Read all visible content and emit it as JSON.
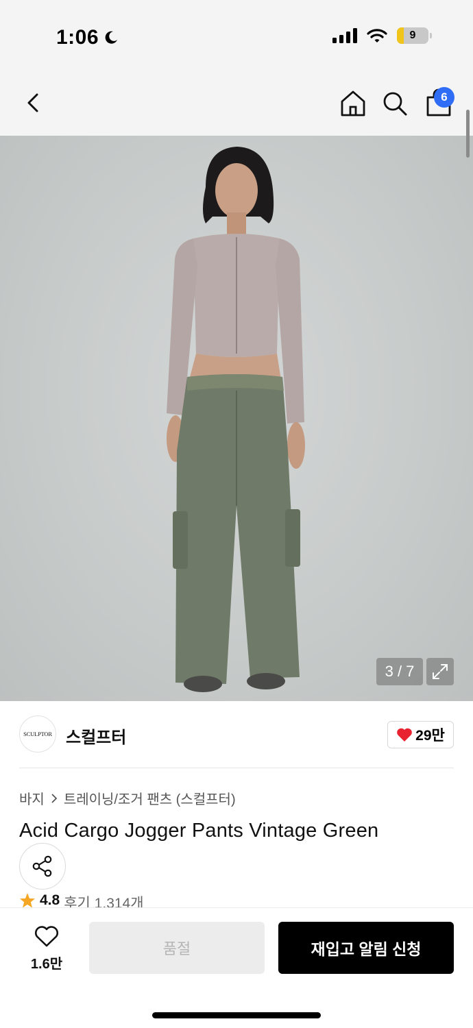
{
  "status_bar": {
    "time": "1:06",
    "battery_level": "9",
    "battery_fraction": 0.09,
    "icons": [
      "moon-icon",
      "cellular-signal-icon",
      "wifi-icon",
      "battery-icon"
    ]
  },
  "nav": {
    "icons": [
      "back-arrow-icon",
      "home-icon",
      "search-icon",
      "shopping-bag-icon"
    ],
    "cart_count": "6"
  },
  "gallery": {
    "counter": "3 / 7",
    "current": 3,
    "total": 7,
    "expand_icon": "expand-arrows-icon"
  },
  "brand": {
    "logo_text": "SCULPTOR",
    "name": "스컬프터",
    "likes": "29만"
  },
  "product": {
    "breadcrumb": [
      "바지",
      "트레이닝/조거 팬츠 (스컬프터)"
    ],
    "title": "Acid Cargo Jogger Pants Vintage Green",
    "rating": "4.8",
    "reviews": "후기 1,314개"
  },
  "bottom_bar": {
    "wish_count": "1.6만",
    "soldout_label": "품절",
    "restock_label": "재입고 알림 신청"
  },
  "colors": {
    "accent_blue": "#2f6df6",
    "heart_red": "#e8232f",
    "star_orange": "#f5a623",
    "black_button": "#000000",
    "disabled_button": "#ececec"
  }
}
